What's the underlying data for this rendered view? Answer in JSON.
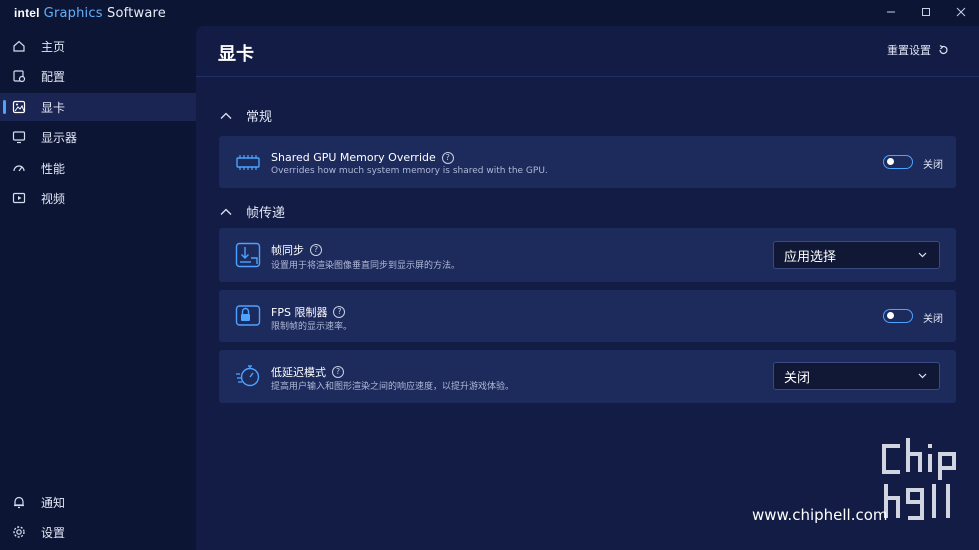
{
  "app": {
    "brand_intel": "intel",
    "brand_graphics": "Graphics",
    "brand_software": "Software"
  },
  "sidebar": {
    "items": [
      {
        "label": "主页",
        "icon": "home-icon"
      },
      {
        "label": "配置",
        "icon": "profile-icon"
      },
      {
        "label": "显卡",
        "icon": "graphics-icon",
        "active": true
      },
      {
        "label": "显示器",
        "icon": "monitor-icon"
      },
      {
        "label": "性能",
        "icon": "performance-gauge-icon"
      },
      {
        "label": "视频",
        "icon": "video-icon"
      }
    ],
    "bottom": [
      {
        "label": "通知",
        "icon": "bell-icon"
      },
      {
        "label": "设置",
        "icon": "gear-icon"
      }
    ]
  },
  "main": {
    "title": "显卡",
    "reset_label": "重置设置",
    "sections": [
      {
        "label": "常规"
      },
      {
        "label": "帧传递"
      }
    ],
    "cards": {
      "shared_memory": {
        "title": "Shared GPU Memory Override",
        "desc": "Overrides how much system memory is shared with the GPU.",
        "state": "关闭"
      },
      "vsync": {
        "title": "帧同步",
        "desc": "设置用于将渲染图像垂直同步到显示屏的方法。",
        "value": "应用选择"
      },
      "fps_limiter": {
        "title": "FPS 限制器",
        "desc": "限制帧的显示速率。",
        "state": "关闭"
      },
      "low_latency": {
        "title": "低延迟模式",
        "desc": "提高用户输入和图形渲染之间的响应速度，以提升游戏体验。",
        "value": "关闭"
      }
    }
  },
  "watermark": {
    "text": "www.chiphell.com",
    "logo": "chip hell"
  },
  "colors": {
    "accent": "#4da3ff",
    "background": "#0d1535",
    "panel": "#131c44",
    "card": "#1d2a5c"
  }
}
